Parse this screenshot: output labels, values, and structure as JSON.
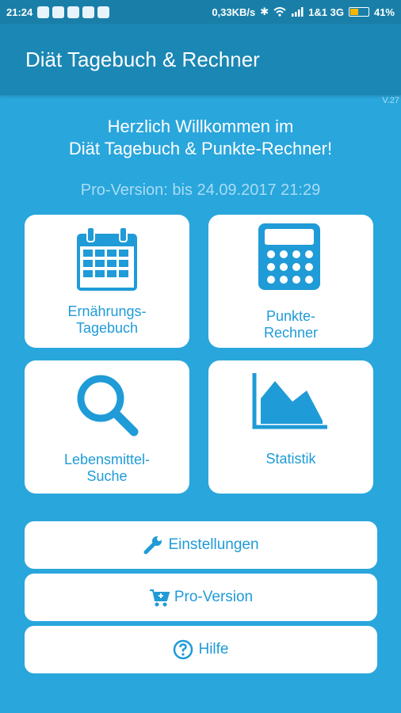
{
  "status_bar": {
    "time": "21:24",
    "net_speed": "0,33KB/s",
    "carrier": "1&1 3G",
    "battery": "41%",
    "battery_level": 0.41
  },
  "app_bar": {
    "title": "Diät Tagebuch & Rechner"
  },
  "version_label": "V.27",
  "welcome": {
    "line1": "Herzlich Willkommen im",
    "line2": "Diät Tagebuch & Punkte-Rechner!"
  },
  "pro_status": "Pro-Version: bis 24.09.2017 21:29",
  "tiles": [
    {
      "line1": "Ernährungs-",
      "line2": "Tagebuch",
      "icon": "calendar-icon"
    },
    {
      "line1": "Punkte-",
      "line2": "Rechner",
      "icon": "calculator-icon"
    },
    {
      "line1": "Lebensmittel-",
      "line2": "Suche",
      "icon": "search-icon"
    },
    {
      "line1": "Statistik",
      "line2": "",
      "icon": "chart-icon"
    }
  ],
  "buttons": [
    {
      "label": "Einstellungen",
      "icon": "wrench-icon"
    },
    {
      "label": "Pro-Version",
      "icon": "cart-icon"
    },
    {
      "label": "Hilfe",
      "icon": "help-icon"
    }
  ],
  "colors": {
    "background": "#29a6dc",
    "app_bar": "#1b87b4",
    "accent": "#1f9bd7"
  }
}
